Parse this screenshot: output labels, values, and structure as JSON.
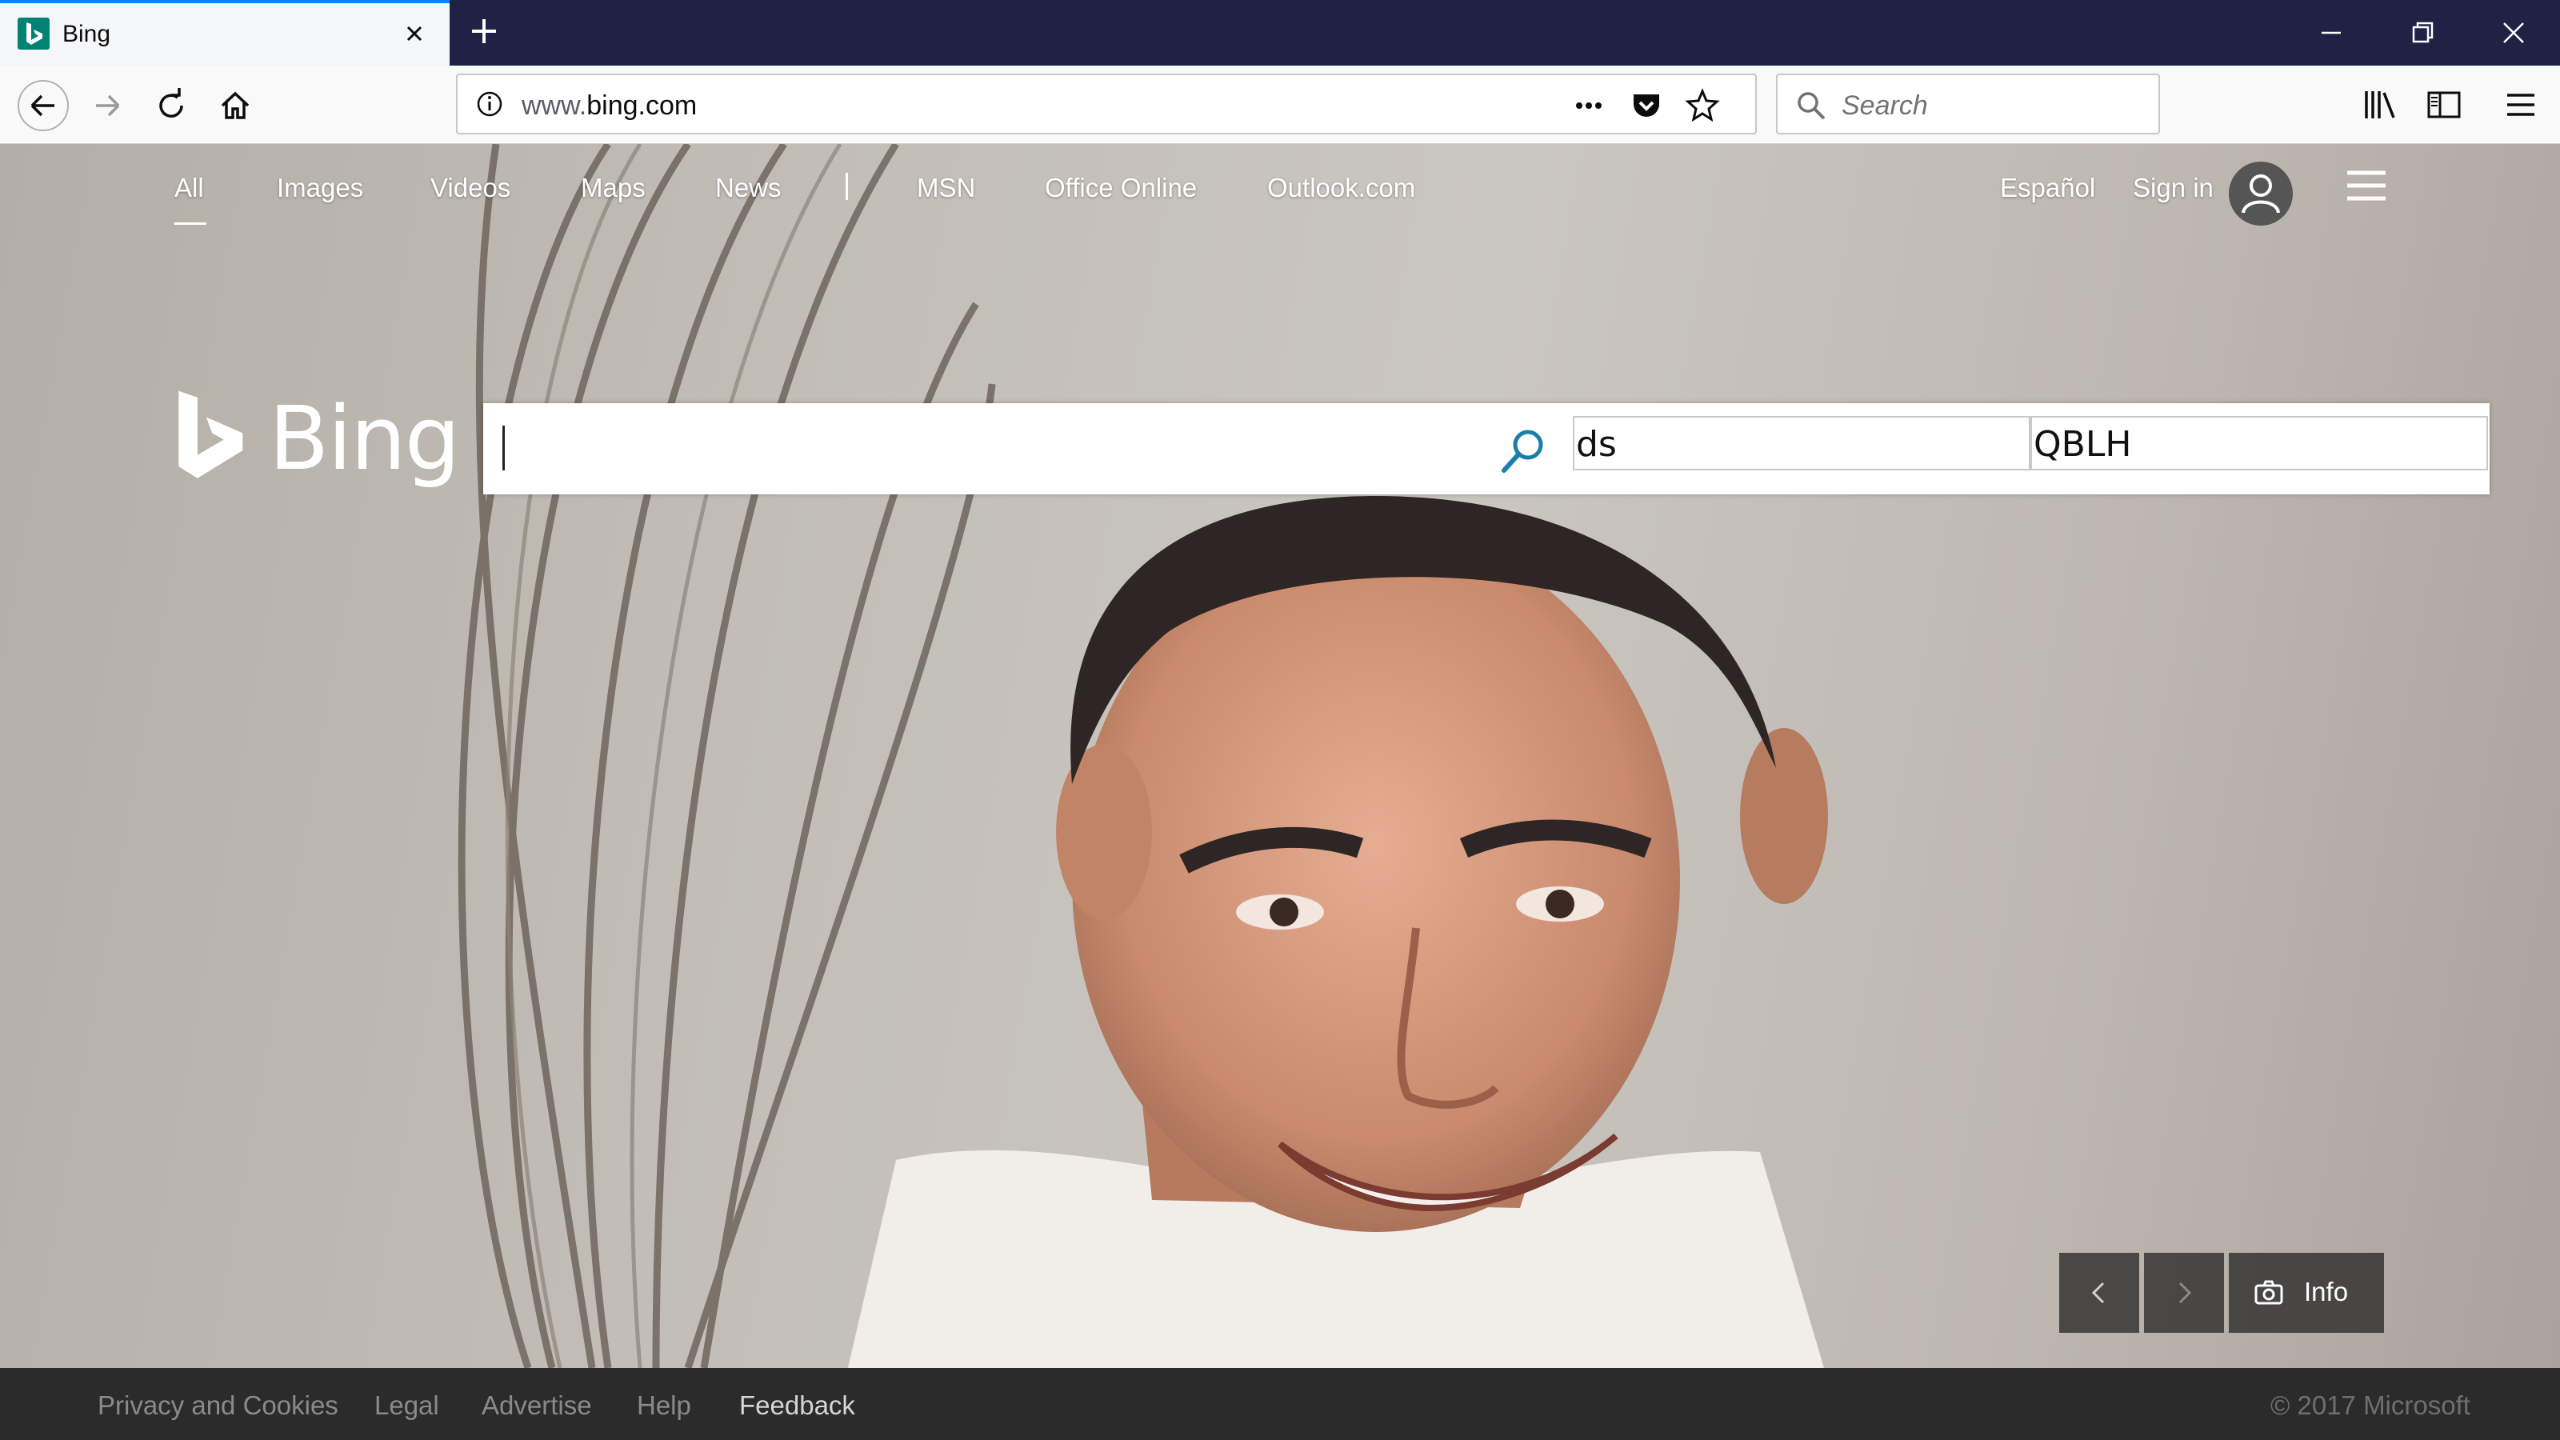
{
  "browser": {
    "tab_title": "Bing",
    "url_prefix": "www.",
    "url_domain": "bing.com",
    "search_placeholder": "Search",
    "accent": "#0a84ff"
  },
  "nav": {
    "scopes": [
      "All",
      "Images",
      "Videos",
      "Maps",
      "News",
      "MSN",
      "Office Online",
      "Outlook.com"
    ],
    "language": "Español",
    "signin": "Sign in"
  },
  "brand": {
    "name": "Bing",
    "color": "#008373"
  },
  "search": {
    "query": "",
    "field1": "ds",
    "field2": "QBLH"
  },
  "hp": {
    "info": "Info"
  },
  "footer": {
    "links": [
      "Privacy and Cookies",
      "Legal",
      "Advertise",
      "Help",
      "Feedback"
    ],
    "copyright": "© 2017 Microsoft"
  },
  "icons": [
    "back-icon",
    "forward-icon",
    "reload-icon",
    "home-icon",
    "info-icon",
    "more-icon",
    "pocket-icon",
    "bookmark-star-icon",
    "search-icon",
    "library-icon",
    "sidebar-icon",
    "menu-icon",
    "camera-icon"
  ]
}
